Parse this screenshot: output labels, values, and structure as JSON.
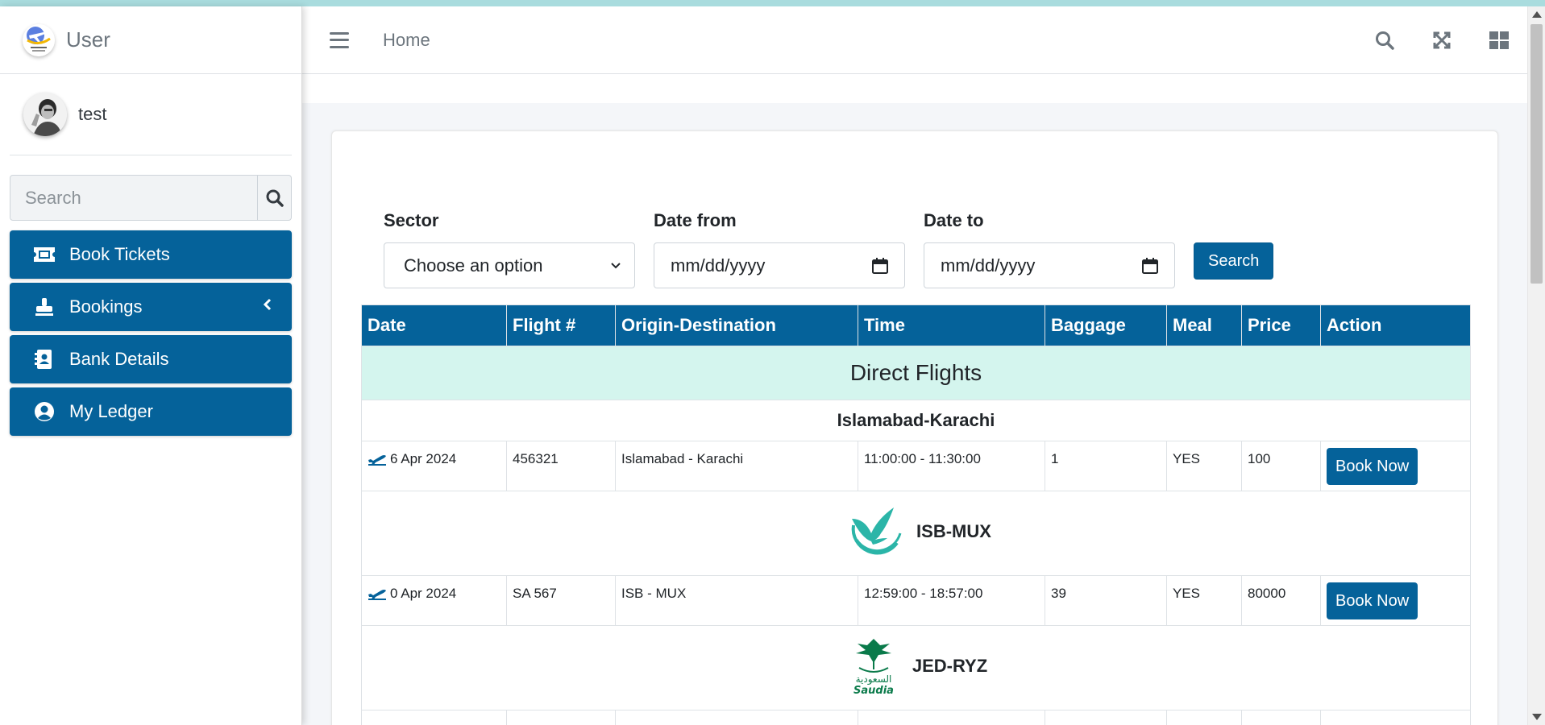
{
  "brand": {
    "title": "User"
  },
  "user": {
    "name": "test"
  },
  "sidebar": {
    "search_placeholder": "Search",
    "items": [
      {
        "label": "Book Tickets",
        "icon": "ticket-icon"
      },
      {
        "label": "Bookings",
        "icon": "stamp-icon"
      },
      {
        "label": "Bank Details",
        "icon": "address-book-icon"
      },
      {
        "label": "My Ledger",
        "icon": "user-circle-icon"
      }
    ]
  },
  "header": {
    "home": "Home"
  },
  "filters": {
    "sector_label": "Sector",
    "sector_value": "Choose an option",
    "date_from_label": "Date from",
    "date_from_value": "mm/dd/yyyy",
    "date_to_label": "Date to",
    "date_to_value": "mm/dd/yyyy",
    "search_button": "Search"
  },
  "table": {
    "columns": [
      "Date",
      "Flight #",
      "Origin-Destination",
      "Time",
      "Baggage",
      "Meal",
      "Price",
      "Action"
    ],
    "section_title": "Direct Flights",
    "groups": [
      {
        "route": "Islamabad-Karachi",
        "flights": [
          {
            "date": "6 Apr 2024",
            "flight": "456321",
            "od": "Islamabad - Karachi",
            "time": "11:00:00 - 11:30:00",
            "baggage": "1",
            "meal": "YES",
            "price": "100",
            "action": "Book Now"
          }
        ]
      },
      {
        "route": "ISB-MUX",
        "airline_logo": "airline-bird-logo",
        "flights": [
          {
            "date": "0 Apr 2024",
            "flight": "SA 567",
            "od": "ISB - MUX",
            "time": "12:59:00 - 18:57:00",
            "baggage": "39",
            "meal": "YES",
            "price": "80000",
            "action": "Book Now"
          }
        ]
      },
      {
        "route": "JED-RYZ",
        "airline_logo": "saudia-logo",
        "logo_text": {
          "arabic": "السعودية",
          "latin": "Saudia"
        }
      }
    ]
  },
  "colors": {
    "primary": "#05629a",
    "section_bg": "#d4f5ee",
    "stripe": "#a9dcde"
  }
}
